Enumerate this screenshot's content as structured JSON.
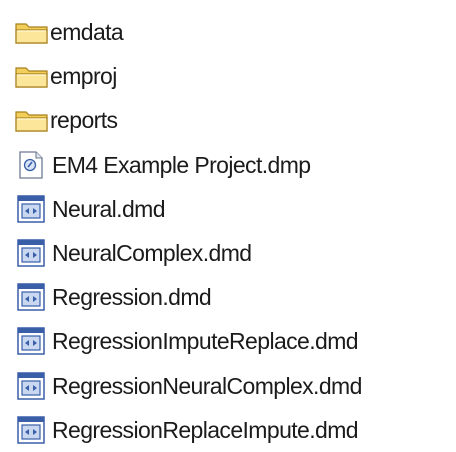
{
  "files": [
    {
      "name": "emdata",
      "type": "folder",
      "icon": "folder-icon"
    },
    {
      "name": "emproj",
      "type": "folder",
      "icon": "folder-icon"
    },
    {
      "name": "reports",
      "type": "folder",
      "icon": "folder-icon"
    },
    {
      "name": "EM4 Example Project.dmp",
      "type": "dmp",
      "icon": "dump-file-icon"
    },
    {
      "name": "Neural.dmd",
      "type": "dmd",
      "icon": "diagram-file-icon"
    },
    {
      "name": "NeuralComplex.dmd",
      "type": "dmd",
      "icon": "diagram-file-icon"
    },
    {
      "name": "Regression.dmd",
      "type": "dmd",
      "icon": "diagram-file-icon"
    },
    {
      "name": "RegressionImputeReplace.dmd",
      "type": "dmd",
      "icon": "diagram-file-icon"
    },
    {
      "name": "RegressionNeuralComplex.dmd",
      "type": "dmd",
      "icon": "diagram-file-icon"
    },
    {
      "name": "RegressionReplaceImpute.dmd",
      "type": "dmd",
      "icon": "diagram-file-icon"
    }
  ],
  "colors": {
    "folder_light": "#f7e08a",
    "folder_dark": "#d9a92c",
    "folder_outline": "#a8801e",
    "file_blue": "#3a5fa8",
    "file_light_blue": "#c9d8f0"
  }
}
